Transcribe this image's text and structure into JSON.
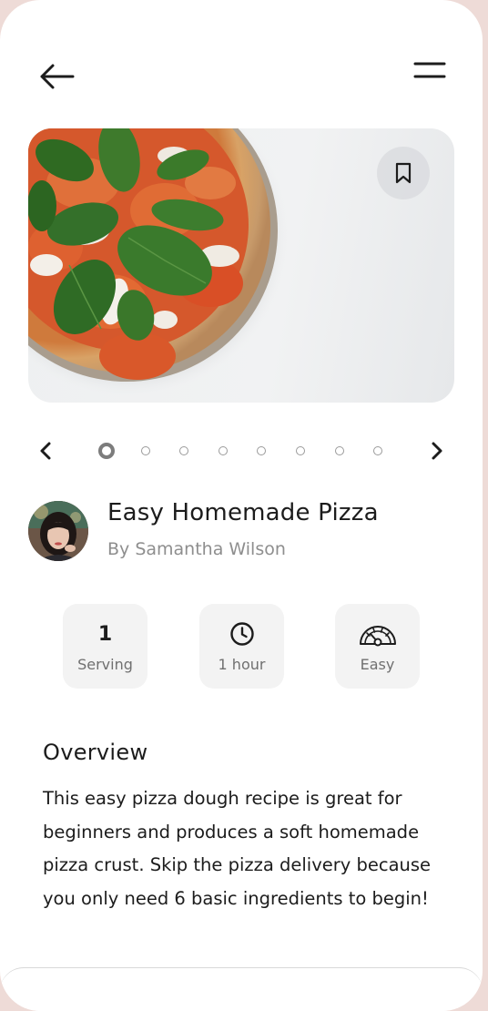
{
  "header": {
    "back_icon": "arrow-left-icon",
    "menu_icon": "menu-icon"
  },
  "hero": {
    "image": "pizza-photo",
    "bookmark_icon": "bookmark-icon"
  },
  "carousel": {
    "prev_icon": "chevron-left-icon",
    "next_icon": "chevron-right-icon",
    "total_slides": 8,
    "active_index": 0
  },
  "recipe": {
    "title": "Easy Homemade Pizza",
    "author": "By Samantha Wilson"
  },
  "stats": [
    {
      "value": "1",
      "label": "Serving"
    },
    {
      "icon": "clock-icon",
      "label": "1 hour"
    },
    {
      "icon": "gauge-icon",
      "label": "Easy"
    }
  ],
  "overview": {
    "heading": "Overview",
    "text": "This easy pizza dough recipe is great for beginners and produces a soft homemade pizza crust. Skip the pizza delivery because you only need 6 basic ingredients to begin!"
  },
  "colors": {
    "background": "#eedbd7",
    "card": "#ffffff",
    "chip": "#f3f3f3",
    "text": "#1c1c1c",
    "muted": "#8e8e8e"
  }
}
